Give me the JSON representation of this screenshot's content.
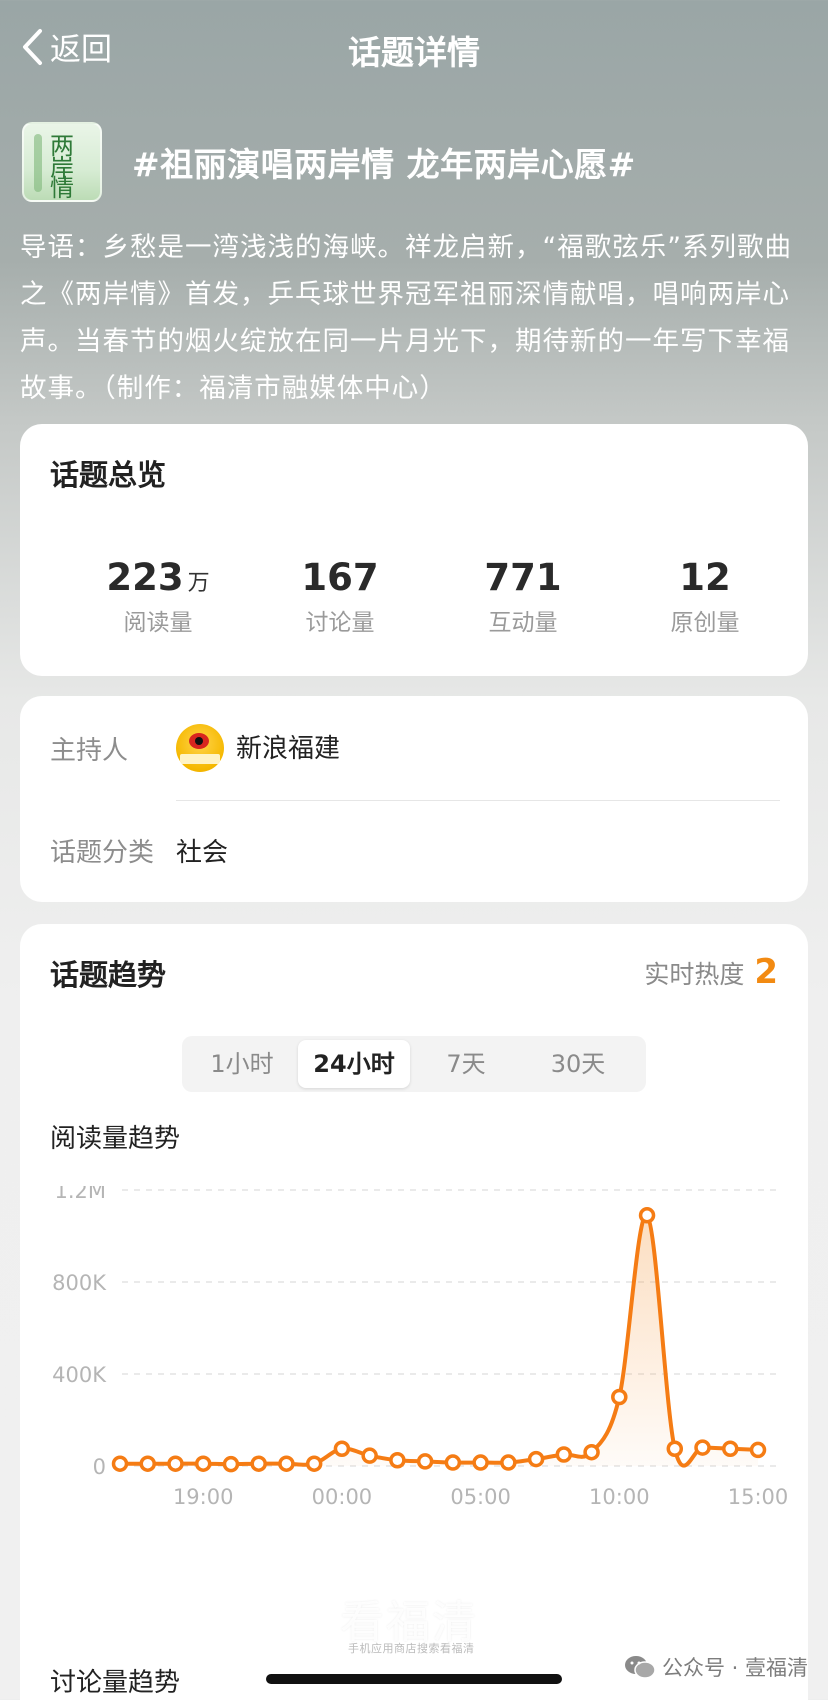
{
  "nav": {
    "back_label": "返回",
    "title": "话题详情"
  },
  "topic": {
    "thumb_text": [
      "两",
      "岸",
      "情"
    ],
    "title": "#祖丽演唱两岸情 龙年两岸心愿#",
    "intro": "导语：乡愁是一湾浅浅的海峡。祥龙启新，“福歌弦乐”系列歌曲之《两岸情》首发，乒乓球世界冠军祖丽深情献唱，唱响两岸心声。当春节的烟火绽放在同一片月光下，期待新的一年写下幸福故事。（制作：福清市融媒体中心）"
  },
  "overview": {
    "title": "话题总览",
    "stats": [
      {
        "value": "223",
        "unit": "万",
        "label": "阅读量"
      },
      {
        "value": "167",
        "unit": "",
        "label": "讨论量"
      },
      {
        "value": "771",
        "unit": "",
        "label": "互动量"
      },
      {
        "value": "12",
        "unit": "",
        "label": "原创量"
      }
    ]
  },
  "host": {
    "host_label": "主持人",
    "host_name": "新浪福建",
    "category_label": "话题分类",
    "category_value": "社会"
  },
  "trend": {
    "title": "话题趋势",
    "heat_label": "实时热度",
    "heat_value": "2",
    "tabs": [
      "1小时",
      "24小时",
      "7天",
      "30天"
    ],
    "active_tab": "24小时",
    "read_title": "阅读量趋势",
    "discuss_title": "讨论量趋势",
    "accent": "#f57c14"
  },
  "chart_data": {
    "type": "line",
    "title": "阅读量趋势",
    "xlabel": "",
    "ylabel": "",
    "ylim": [
      0,
      1200000
    ],
    "y_ticks": [
      0,
      400000,
      800000,
      1200000
    ],
    "y_tick_labels": [
      "0",
      "400K",
      "800K",
      "1.2M"
    ],
    "x_tick_labels": [
      "19:00",
      "00:00",
      "05:00",
      "10:00",
      "15:00"
    ],
    "x_tick_hours": [
      3,
      8,
      13,
      18,
      23
    ],
    "grid": true,
    "legend": "none",
    "series": [
      {
        "hours": [
          0,
          1,
          2,
          3,
          4,
          5,
          6,
          7,
          8,
          9,
          10,
          11,
          12,
          13,
          14,
          15,
          16,
          17,
          18,
          19,
          20,
          21,
          22,
          23
        ],
        "values": [
          10000,
          10000,
          10000,
          10000,
          8000,
          10000,
          10000,
          10000,
          75000,
          45000,
          25000,
          20000,
          15000,
          15000,
          15000,
          30000,
          50000,
          60000,
          300000,
          1090000,
          75000,
          80000,
          75000,
          70000
        ]
      }
    ]
  },
  "footer": {
    "watermark": "看福清",
    "watermark_sub": "手机应用商店搜索看福清",
    "wechat": "公众号 · 壹福清"
  }
}
